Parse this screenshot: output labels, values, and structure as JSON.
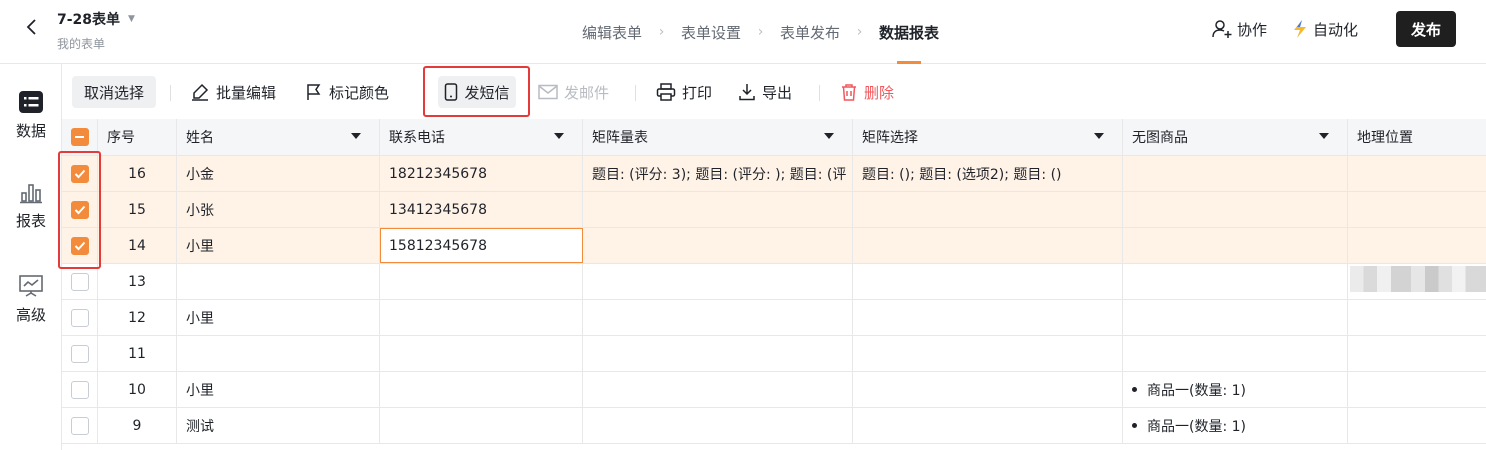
{
  "header": {
    "title": "7-28表单",
    "subtitle": "我的表单",
    "steps": [
      "编辑表单",
      "表单设置",
      "表单发布",
      "数据报表"
    ],
    "active_step": 3,
    "collab_label": "协作",
    "automation_label": "自动化",
    "publish_label": "发布"
  },
  "leftnav": {
    "items": [
      {
        "label": "数据",
        "icon": "list-icon"
      },
      {
        "label": "报表",
        "icon": "bar-chart-icon"
      },
      {
        "label": "高级",
        "icon": "presentation-chart-icon"
      }
    ]
  },
  "toolbar": {
    "cancel_select": "取消选择",
    "batch_edit": "批量编辑",
    "mark_color": "标记颜色",
    "send_sms": "发短信",
    "send_email": "发邮件",
    "print": "打印",
    "export": "导出",
    "delete": "删除"
  },
  "table": {
    "columns": [
      "序号",
      "姓名",
      "联系电话",
      "矩阵量表",
      "矩阵选择",
      "无图商品",
      "地理位置"
    ],
    "rows": [
      {
        "no": "16",
        "name": "小金",
        "phone": "18212345678",
        "scale": "题目: (评分: 3); 题目: (评分: ); 题目: (评",
        "choice": "题目: (); 题目: (选项2); 题目: ()",
        "goods": "",
        "checked": true
      },
      {
        "no": "15",
        "name": "小张",
        "phone": "13412345678",
        "scale": "",
        "choice": "",
        "goods": "",
        "checked": true
      },
      {
        "no": "14",
        "name": "小里",
        "phone": "15812345678",
        "scale": "",
        "choice": "",
        "goods": "",
        "checked": true
      },
      {
        "no": "13",
        "name": "",
        "phone": "",
        "scale": "",
        "choice": "",
        "goods": "",
        "checked": false
      },
      {
        "no": "12",
        "name": "小里",
        "phone": "",
        "scale": "",
        "choice": "",
        "goods": "",
        "checked": false
      },
      {
        "no": "11",
        "name": "",
        "phone": "",
        "scale": "",
        "choice": "",
        "goods": "",
        "checked": false
      },
      {
        "no": "10",
        "name": "小里",
        "phone": "",
        "scale": "",
        "choice": "",
        "goods": "商品一(数量: 1)",
        "checked": false
      },
      {
        "no": "9",
        "name": "测试",
        "phone": "",
        "scale": "",
        "choice": "",
        "goods": "商品一(数量: 1)",
        "checked": false
      }
    ]
  },
  "colors": {
    "accent": "#f28b3c",
    "selected_row": "#fff3e8",
    "highlight_box": "#e53a3a",
    "danger": "#f0595d"
  }
}
